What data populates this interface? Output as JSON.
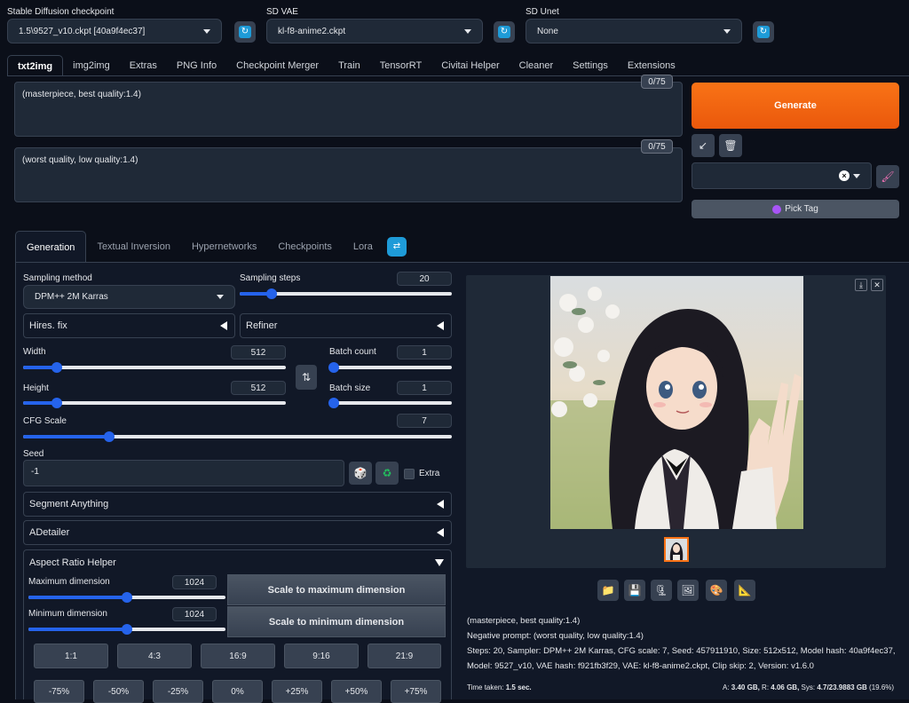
{
  "header": {
    "checkpoint": {
      "label": "Stable Diffusion checkpoint",
      "value": "1.5\\9527_v10.ckpt [40a9f4ec37]"
    },
    "vae": {
      "label": "SD VAE",
      "value": "kl-f8-anime2.ckpt"
    },
    "unet": {
      "label": "SD Unet",
      "value": "None"
    }
  },
  "tabs": [
    "txt2img",
    "img2img",
    "Extras",
    "PNG Info",
    "Checkpoint Merger",
    "Train",
    "TensorRT",
    "Civitai Helper",
    "Cleaner",
    "Settings",
    "Extensions"
  ],
  "prompt": {
    "text": "(masterpiece, best quality:1.4)",
    "counter": "0/75"
  },
  "negative_prompt": {
    "text": "(worst quality, low quality:1.4)",
    "counter": "0/75"
  },
  "generate_label": "Generate",
  "pick_tag_label": "Pick Tag",
  "subtabs": [
    "Generation",
    "Textual Inversion",
    "Hypernetworks",
    "Checkpoints",
    "Lora"
  ],
  "sampling": {
    "method_label": "Sampling method",
    "method": "DPM++ 2M Karras",
    "steps_label": "Sampling steps",
    "steps": "20",
    "steps_fill": 0.15
  },
  "hires_label": "Hires. fix",
  "refiner_label": "Refiner",
  "width": {
    "label": "Width",
    "value": "512",
    "fill": 0.13
  },
  "height": {
    "label": "Height",
    "value": "512",
    "fill": 0.13
  },
  "batch_count": {
    "label": "Batch count",
    "value": "1",
    "fill": 0.0
  },
  "batch_size": {
    "label": "Batch size",
    "value": "1",
    "fill": 0.0
  },
  "cfg": {
    "label": "CFG Scale",
    "value": "7",
    "fill": 0.2
  },
  "seed": {
    "label": "Seed",
    "value": "-1",
    "extra_label": "Extra"
  },
  "accordions": {
    "segment": "Segment Anything",
    "adetailer": "ADetailer",
    "aspect": "Aspect Ratio Helper"
  },
  "aspect": {
    "max_label": "Maximum dimension",
    "max_value": "1024",
    "max_fill": 0.5,
    "min_label": "Minimum dimension",
    "min_value": "1024",
    "min_fill": 0.5,
    "scale_max": "Scale to maximum dimension",
    "scale_min": "Scale to minimum dimension",
    "ratios": [
      "1:1",
      "4:3",
      "16:9",
      "9:16",
      "21:9"
    ],
    "percents": [
      "-75%",
      "-50%",
      "-25%",
      "0%",
      "+25%",
      "+50%",
      "+75%"
    ]
  },
  "output": {
    "info_line1": "(masterpiece, best quality:1.4)",
    "info_line2": "Negative prompt: (worst quality, low quality:1.4)",
    "info_line3": "Steps: 20, Sampler: DPM++ 2M Karras, CFG scale: 7, Seed: 457911910, Size: 512x512, Model hash: 40a9f4ec37,",
    "info_line4": "Model: 9527_v10, VAE hash: f921fb3f29, VAE: kl-f8-anime2.ckpt, Clip skip: 2, Version: v1.6.0",
    "time_label": "Time taken:",
    "time_value": "1.5 sec.",
    "vram_a_label": "A:",
    "vram_a": "3.40 GB,",
    "vram_r_label": "R:",
    "vram_r": "4.06 GB,",
    "vram_sys_label": "Sys:",
    "vram_sys": "4.7/23.9883 GB",
    "vram_pct": "(19.6%)"
  },
  "colors": {
    "accent": "#f97316",
    "slider": "#2563eb",
    "bg": "#0b0f19",
    "panel": "#111827"
  }
}
